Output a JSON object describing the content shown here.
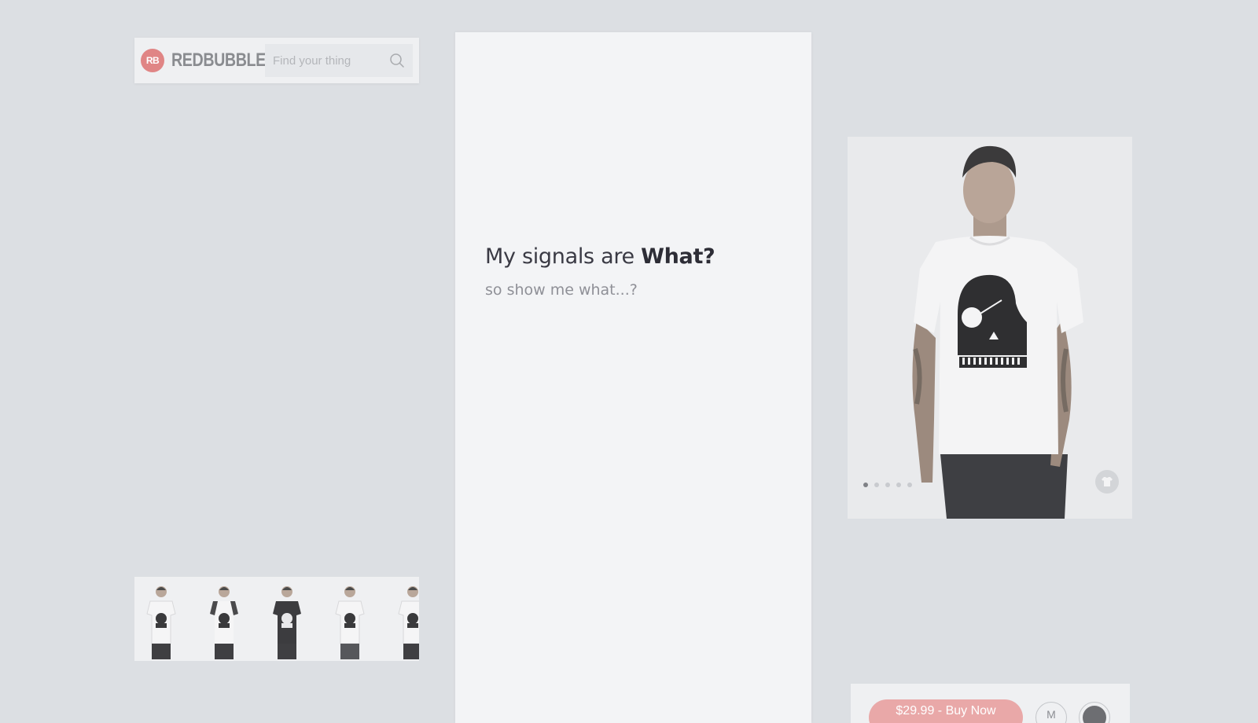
{
  "header": {
    "logo_badge": "RB",
    "brand": "REDBUBBLE",
    "search_placeholder": "Find your thing"
  },
  "main": {
    "headline_prefix": "My signals are ",
    "headline_bold": "What?",
    "subheadline": "so show me what...?"
  },
  "product": {
    "carousel_total": 5,
    "carousel_active_index": 0,
    "buy_label": "$29.99 - Buy Now",
    "size_label": "M",
    "selected_color": "#6d6e72"
  },
  "thumbnails": [
    {
      "shirt": "white"
    },
    {
      "shirt": "raglan"
    },
    {
      "shirt": "dark"
    },
    {
      "shirt": "white"
    },
    {
      "shirt": "white"
    }
  ],
  "colors": {
    "background": "#dcdfe3",
    "panel": "#f3f4f6",
    "brand_accent": "#e08585",
    "buy_button": "#e9a8a8"
  }
}
